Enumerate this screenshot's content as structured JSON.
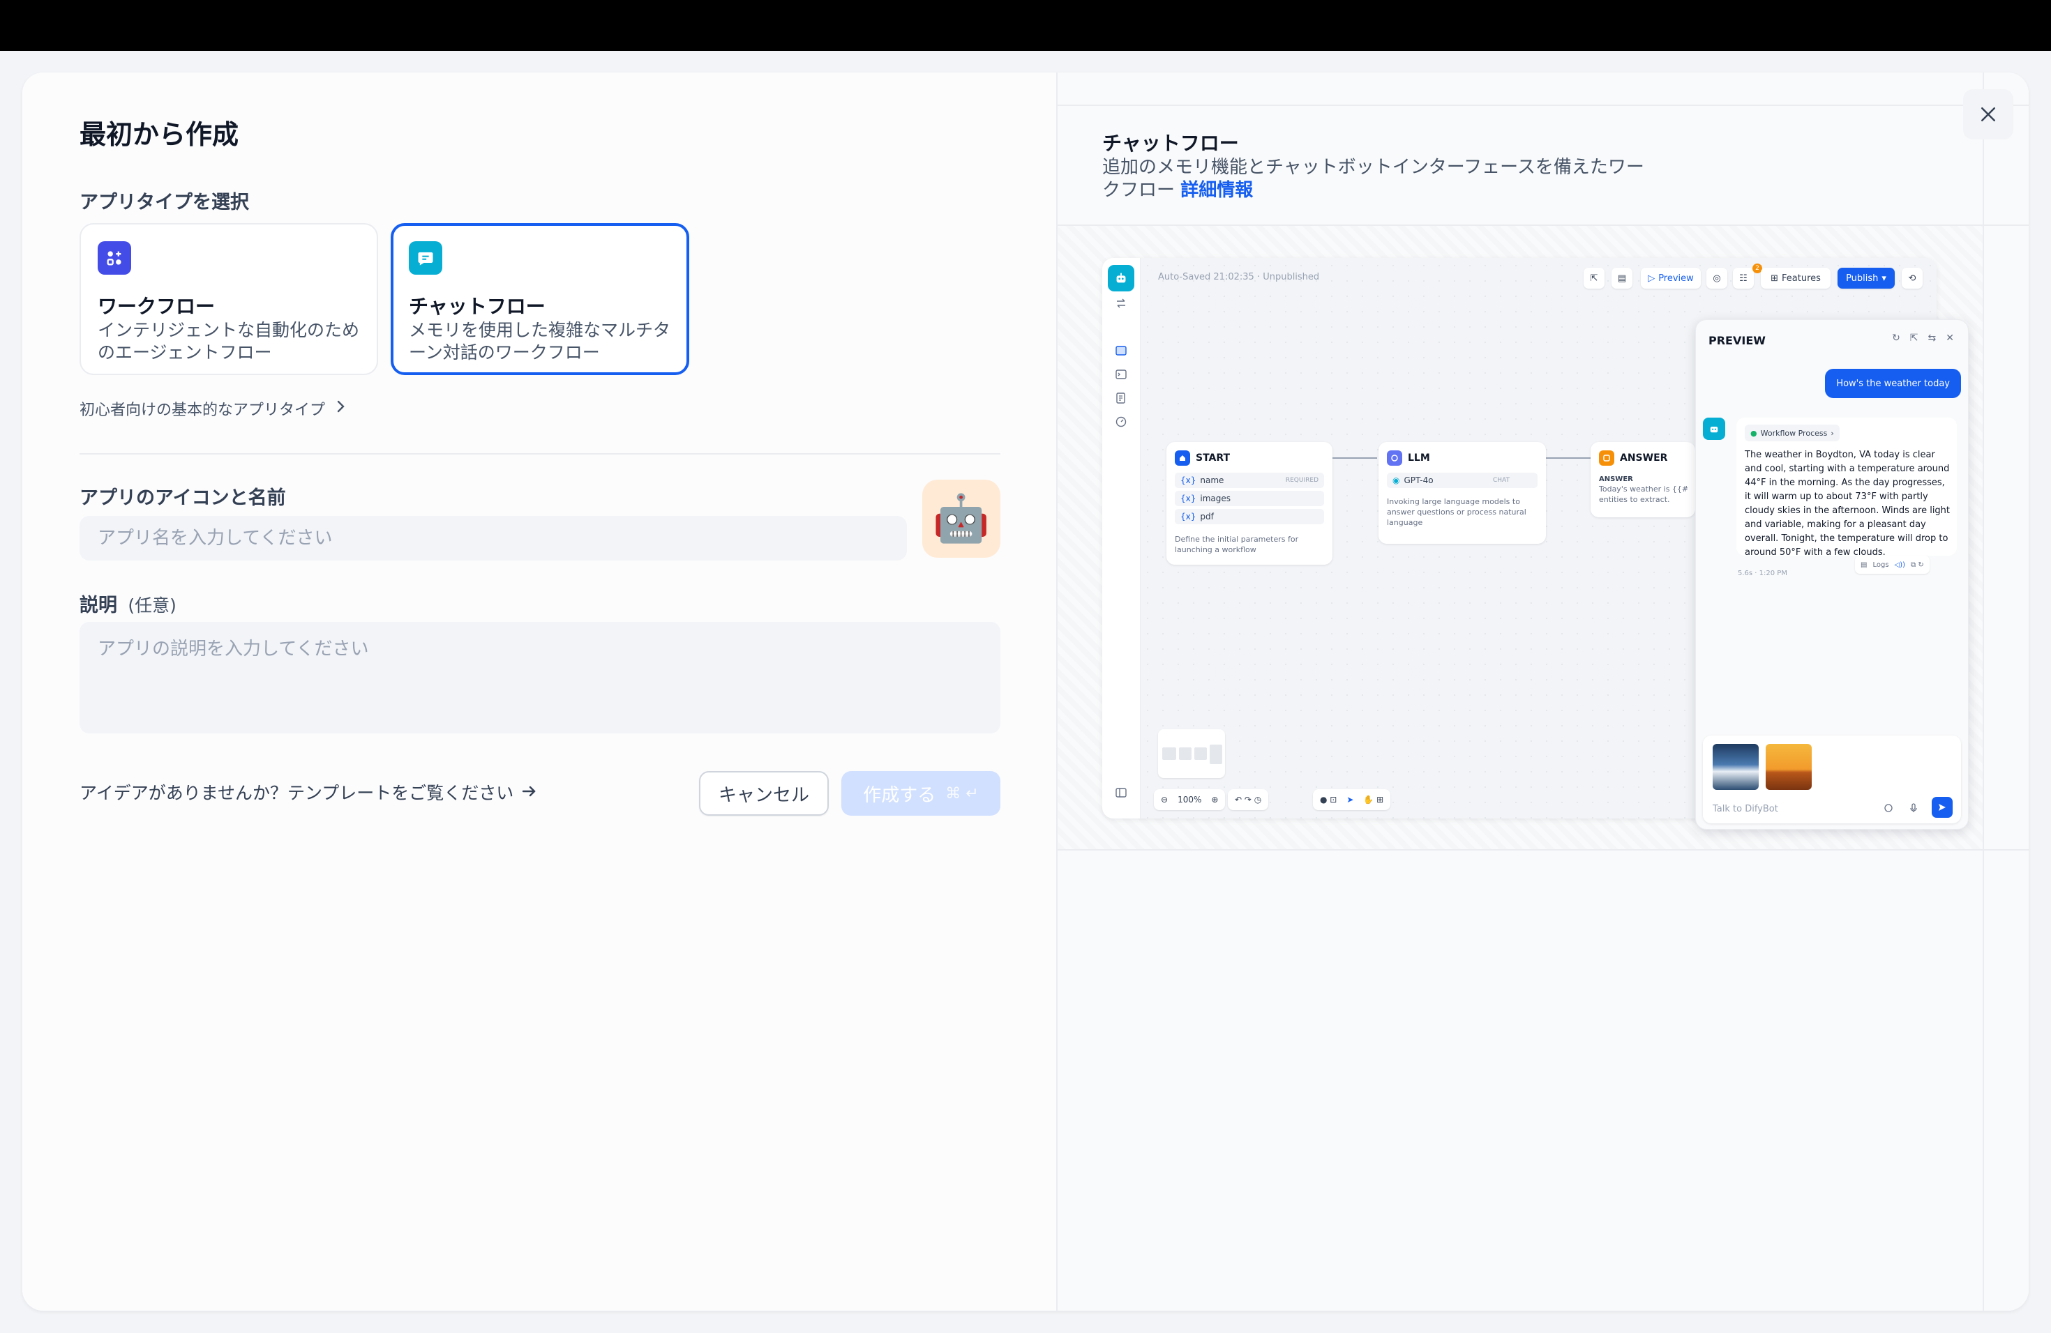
{
  "dialog": {
    "title": "最初から作成",
    "app_type_label": "アプリタイプを選択",
    "types": [
      {
        "name": "ワークフロー",
        "desc": "インテリジェントな自動化のためのエージェントフロー",
        "icon": "workflow-icon",
        "color": "#444ce7"
      },
      {
        "name": "チャットフロー",
        "desc": "メモリを使用した複雑なマルチターン対話のワークフロー",
        "icon": "chatflow-icon",
        "color": "#06aed4",
        "selected": true
      }
    ],
    "basic_types_link": "初心者向けの基本的なアプリタイプ",
    "icon_name_label": "アプリのアイコンと名前",
    "name_placeholder": "アプリ名を入力してください",
    "app_icon": "🤖",
    "description_label": "説明",
    "description_optional": "(任意)",
    "description_placeholder": "アプリの説明を入力してください",
    "template_link": "アイデアがありませんか？テンプレートをご覧ください",
    "cancel_label": "キャンセル",
    "create_label": "作成する",
    "create_shortcut": "⌘ ↵",
    "accent_color": "#155eef"
  },
  "preview": {
    "title": "チャットフロー",
    "description": "追加のメモリ機能とチャットボットインターフェースを備えたワークフロー",
    "more_link": "詳細情報",
    "screenshot": {
      "autosave": "Auto-Saved 21:02:35 · Unpublished",
      "toolbar": {
        "preview": "Preview",
        "features": "Features",
        "publish": "Publish",
        "badge": "2"
      },
      "nodes": {
        "start": {
          "title": "START",
          "vars": [
            "name",
            "images",
            "pdf"
          ],
          "required": "REQUIRED",
          "note": "Define the initial parameters for launching a workflow"
        },
        "llm": {
          "title": "LLM",
          "model": "GPT-4o",
          "mode": "CHAT",
          "note": "Invoking large language models to answer questions or process natural language"
        },
        "answer": {
          "title": "ANSWER",
          "label": "ANSWER",
          "note": "Today's weather is {{#",
          "note2": "entities to extract."
        }
      },
      "zoom": "100%",
      "chat": {
        "title": "PREVIEW",
        "user_message": "How's the weather today",
        "workflow_process": "Workflow Process",
        "bot_reply": "The weather in Boydton, VA today is clear and cool, starting with a temperature around 44°F in the morning. As the day progresses, it will warm up to about 73°F with partly cloudy skies in the afternoon. Winds are light and variable, making for a pleasant day overall. Tonight, the temperature will drop to around 50°F with a few clouds.",
        "meta": "5.6s · 1:20 PM",
        "logs": "Logs",
        "input_placeholder": "Talk to DifyBot"
      }
    }
  }
}
